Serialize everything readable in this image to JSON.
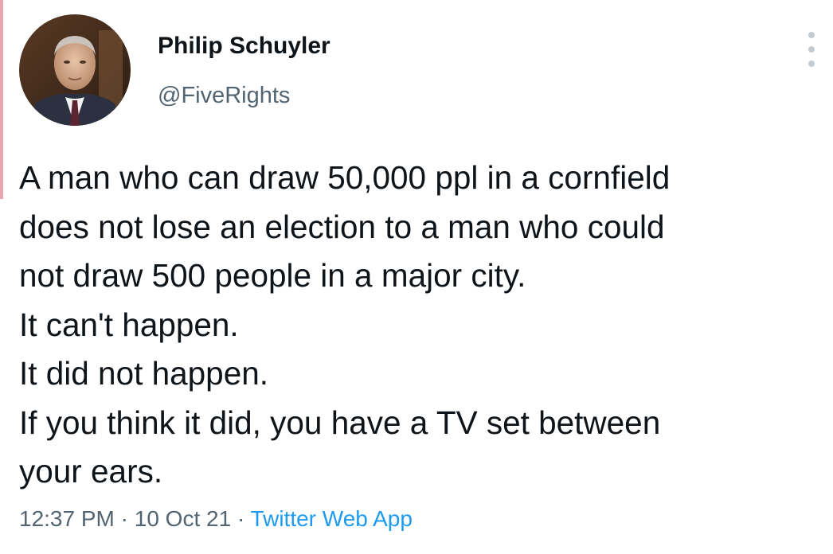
{
  "author": {
    "name": "Philip Schuyler",
    "handle": "@FiveRights"
  },
  "tweet": {
    "lines": [
      "A man who can draw 50,000 ppl in a cornfield",
      "does not lose an election to a man who could",
      "not draw 500 people in a major city.",
      "It can't happen.",
      "It did not happen.",
      "If you think it did, you have a TV set between",
      "your ears."
    ]
  },
  "meta": {
    "time": "12:37 PM",
    "separator": "·",
    "date": "10 Oct 21",
    "source": "Twitter Web App"
  },
  "icons": {
    "more": "vertical-ellipsis-icon",
    "avatar": "avatar"
  },
  "colors": {
    "text": "#0f1419",
    "secondary": "#536471",
    "link": "#1d9bf0",
    "accent_bar": "#e9a5b0"
  }
}
